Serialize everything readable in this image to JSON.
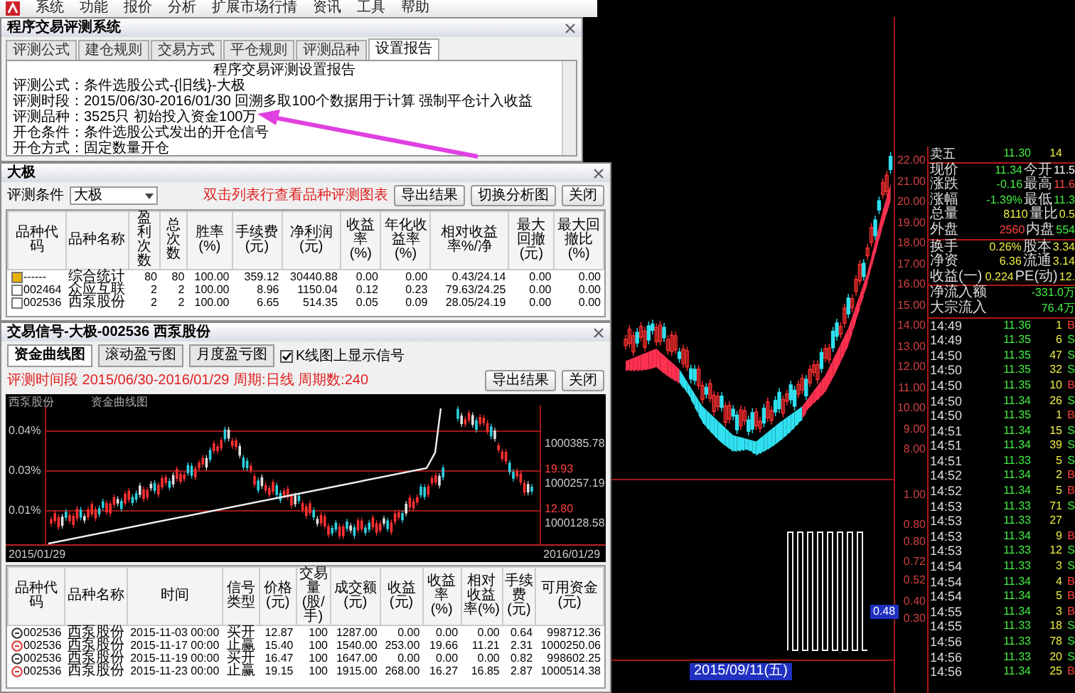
{
  "menu_bar": {
    "items": [
      "系统",
      "功能",
      "报价",
      "分析",
      "扩展市场行情",
      "资讯",
      "工具",
      "帮助"
    ]
  },
  "report_dialog": {
    "title": "程序交易评测系统",
    "tabs": [
      {
        "label": "评测公式",
        "selected": false
      },
      {
        "label": "建仓规则",
        "selected": false
      },
      {
        "label": "交易方式",
        "selected": false
      },
      {
        "label": "平仓规则",
        "selected": false
      },
      {
        "label": "评测品种",
        "selected": false
      },
      {
        "label": "设置报告",
        "selected": true
      }
    ],
    "report_title": "程序交易评测设置报告",
    "lines": [
      "评测公式：条件选股公式-{旧线}-大极",
      "评测时段：2015/06/30-2016/01/30 回溯多取100个数据用于计算 强制平仓计入收益",
      "评测品种：3525只 初始投入资金100万",
      "开仓条件：条件选股公式发出的开仓信号",
      "开仓方式：固定数量开仓"
    ]
  },
  "stats_dialog": {
    "title": "大极",
    "filter_label": "评测条件",
    "filter_value": "大极",
    "hint": "双击列表行查看品种评测图表",
    "buttons": [
      "导出结果",
      "切换分析图",
      "关闭"
    ],
    "columns": [
      "品种代码",
      "品种名称",
      "盈利次数",
      "总次数",
      "胜率(%)",
      "手续费(元)",
      "净利润(元)",
      "收益率(%)",
      "年化收益率(%)",
      "相对收益率%/净",
      "最大回撤(元)",
      "最大回撤比(%)"
    ],
    "rows": [
      {
        "kind": "summary",
        "cells": [
          "------",
          "综合统计",
          "80",
          "80",
          "100.00",
          "359.12",
          "30440.88",
          "0.00",
          "0.00",
          "0.43/24.14",
          "0.00",
          "0.00"
        ]
      },
      {
        "kind": "stock",
        "cells": [
          "002464",
          "众应互联",
          "2",
          "2",
          "100.00",
          "8.96",
          "1150.04",
          "0.12",
          "0.23",
          "79.63/24.25",
          "0.00",
          "0.00"
        ]
      },
      {
        "kind": "stock",
        "cells": [
          "002536",
          "西泵股份",
          "2",
          "2",
          "100.00",
          "6.65",
          "514.35",
          "0.05",
          "0.09",
          "28.05/24.19",
          "0.00",
          "0.00"
        ]
      }
    ]
  },
  "signal_dialog": {
    "title": "交易信号-大极-002536 西泵股份",
    "tabs": [
      {
        "label": "资金曲线图",
        "selected": true
      },
      {
        "label": "滚动盈亏图",
        "selected": false
      },
      {
        "label": "月度盈亏图",
        "selected": false
      }
    ],
    "show_signals": {
      "label": "K线图上显示信号",
      "checked": true
    },
    "period_info": "评测时间段 2015/06/30-2016/01/29 周期:日线 周期数:240",
    "buttons": [
      "导出结果",
      "关闭"
    ],
    "chart": {
      "series_name": "西泵股份",
      "chart_title": "资金曲线图",
      "left_ticks": [
        "0.04%",
        "0.03%",
        "0.01%"
      ],
      "right_ticks": [
        "1000385.78",
        "1000257.19",
        "1000128.58"
      ],
      "price_marks": [
        "19.93",
        "12.80"
      ],
      "x_start": "2015/01/29",
      "x_end": "2016/01/29"
    },
    "columns": [
      "品种代码",
      "品种名称",
      "时间",
      "信号类型",
      "价格(元)",
      "交易量(股/手)",
      "成交额(元)",
      "收益(元)",
      "收益率(%)",
      "相对收益率(%)",
      "手续费(元)",
      "可用资金(元)"
    ],
    "rows": [
      {
        "kind": "buy",
        "cells": [
          "002536",
          "西泵股份",
          "2015-11-03 00:00",
          "买开",
          "12.87",
          "100",
          "1287.00",
          "0.00",
          "0.00",
          "0.00",
          "0.64",
          "998712.36"
        ]
      },
      {
        "kind": "sell",
        "cells": [
          "002536",
          "西泵股份",
          "2015-11-17 00:00",
          "止赢",
          "15.40",
          "100",
          "1540.00",
          "253.00",
          "19.66",
          "11.21",
          "2.31",
          "1000250.06"
        ]
      },
      {
        "kind": "buy",
        "cells": [
          "002536",
          "西泵股份",
          "2015-11-19 00:00",
          "买开",
          "16.47",
          "100",
          "1647.00",
          "0.00",
          "0.00",
          "0.00",
          "0.82",
          "998602.25"
        ]
      },
      {
        "kind": "sell",
        "cells": [
          "002536",
          "西泵股份",
          "2015-11-23 00:00",
          "止赢",
          "19.15",
          "100",
          "1915.00",
          "268.00",
          "16.27",
          "16.85",
          "2.87",
          "1000514.38"
        ]
      }
    ]
  },
  "market_chart": {
    "price_axis": [
      "22.00",
      "21.00",
      "20.00",
      "19.00",
      "18.00",
      "17.00",
      "16.00",
      "15.00",
      "14.00",
      "13.00",
      "12.00",
      "11.00",
      "10.00",
      "9.00",
      "8.00"
    ],
    "indicator_axis": [
      "1.00",
      "0.80",
      "0.80",
      "0.72",
      "0.52",
      "0.40",
      "0.30"
    ],
    "cursor_value": "0.48",
    "date_label": "2015/09/11(五)"
  },
  "quote_panel": {
    "ask": {
      "label": "卖五",
      "price": "11.30",
      "volume": "14"
    },
    "stats": [
      {
        "label": "现价",
        "value": "11.34",
        "color": "#44ee44"
      },
      {
        "label": "今开",
        "value": "11.5",
        "color": "#ffffff"
      },
      {
        "label": "涨跌",
        "value": "-0.16",
        "color": "#44ee44"
      },
      {
        "label": "最高",
        "value": "11.6",
        "color": "#ff4444"
      },
      {
        "label": "涨幅",
        "value": "-1.39%",
        "color": "#44ee44"
      },
      {
        "label": "最低",
        "value": "11.3",
        "color": "#44ee44"
      },
      {
        "label": "总量",
        "value": "8110",
        "color": "#eeee44"
      },
      {
        "label": "量比",
        "value": "0.5",
        "color": "#eeee44"
      },
      {
        "label": "外盘",
        "value": "2560",
        "color": "#ff4444"
      },
      {
        "label": "内盘",
        "value": "554",
        "color": "#44ee44"
      },
      {
        "label": "换手",
        "value": "0.26%",
        "color": "#eeee44"
      },
      {
        "label": "股本",
        "value": "3.34",
        "color": "#eeee44"
      },
      {
        "label": "净资",
        "value": "6.36",
        "color": "#eeee44"
      },
      {
        "label": "流通",
        "value": "3.14",
        "color": "#eeee44"
      },
      {
        "label": "收益(一)",
        "value": "0.224",
        "color": "#eeee44"
      },
      {
        "label": "PE(动)",
        "value": "12.",
        "color": "#eeee44"
      }
    ],
    "flows": [
      {
        "label": "净流入额",
        "value": "-331.0万",
        "color": "#44ee44"
      },
      {
        "label": "大宗流入",
        "value": "76.4万",
        "color": "#44ee44"
      }
    ],
    "ticks": [
      {
        "time": "14:49",
        "price": "11.36",
        "volume": "1",
        "side": "B",
        "kind": "buy"
      },
      {
        "time": "14:49",
        "price": "11.35",
        "volume": "6",
        "side": "S",
        "kind": "sell"
      },
      {
        "time": "14:50",
        "price": "11.35",
        "volume": "47",
        "side": "S",
        "kind": "sell"
      },
      {
        "time": "14:50",
        "price": "11.35",
        "volume": "32",
        "side": "S",
        "kind": "sell"
      },
      {
        "time": "14:50",
        "price": "11.35",
        "volume": "10",
        "side": "B",
        "kind": "buy"
      },
      {
        "time": "14:50",
        "price": "11.34",
        "volume": "26",
        "side": "S",
        "kind": "sell"
      },
      {
        "time": "14:50",
        "price": "11.35",
        "volume": "1",
        "side": "B",
        "kind": "buy"
      },
      {
        "time": "14:51",
        "price": "11.34",
        "volume": "15",
        "side": "S",
        "kind": "sell"
      },
      {
        "time": "14:51",
        "price": "11.34",
        "volume": "39",
        "side": "S",
        "kind": "sell"
      },
      {
        "time": "14:51",
        "price": "11.33",
        "volume": "5",
        "side": "S",
        "kind": "sell"
      },
      {
        "time": "14:52",
        "price": "11.34",
        "volume": "2",
        "side": "B",
        "kind": "buy"
      },
      {
        "time": "14:52",
        "price": "11.34",
        "volume": "5",
        "side": "B",
        "kind": "buy"
      },
      {
        "time": "14:53",
        "price": "11.33",
        "volume": "71",
        "side": "S",
        "kind": "sell"
      },
      {
        "time": "14:53",
        "price": "11.33",
        "volume": "27",
        "kind": "none"
      },
      {
        "time": "14:53",
        "price": "11.34",
        "volume": "9",
        "side": "B",
        "kind": "buy"
      },
      {
        "time": "14:53",
        "price": "11.33",
        "volume": "12",
        "side": "S",
        "kind": "sell"
      },
      {
        "time": "14:54",
        "price": "11.33",
        "volume": "3",
        "side": "S",
        "kind": "sell"
      },
      {
        "time": "14:54",
        "price": "11.34",
        "volume": "4",
        "side": "B",
        "kind": "buy"
      },
      {
        "time": "14:54",
        "price": "11.34",
        "volume": "5",
        "side": "B",
        "kind": "buy"
      },
      {
        "time": "14:55",
        "price": "11.34",
        "volume": "3",
        "side": "B",
        "kind": "buy"
      },
      {
        "time": "14:55",
        "price": "11.33",
        "volume": "18",
        "side": "S",
        "kind": "sell"
      },
      {
        "time": "14:56",
        "price": "11.33",
        "volume": "78",
        "side": "S",
        "kind": "sell"
      },
      {
        "time": "14:56",
        "price": "11.33",
        "volume": "20",
        "side": "S",
        "kind": "sell"
      },
      {
        "time": "14:56",
        "price": "11.34",
        "volume": "25",
        "side": "B",
        "kind": "buy"
      }
    ]
  }
}
